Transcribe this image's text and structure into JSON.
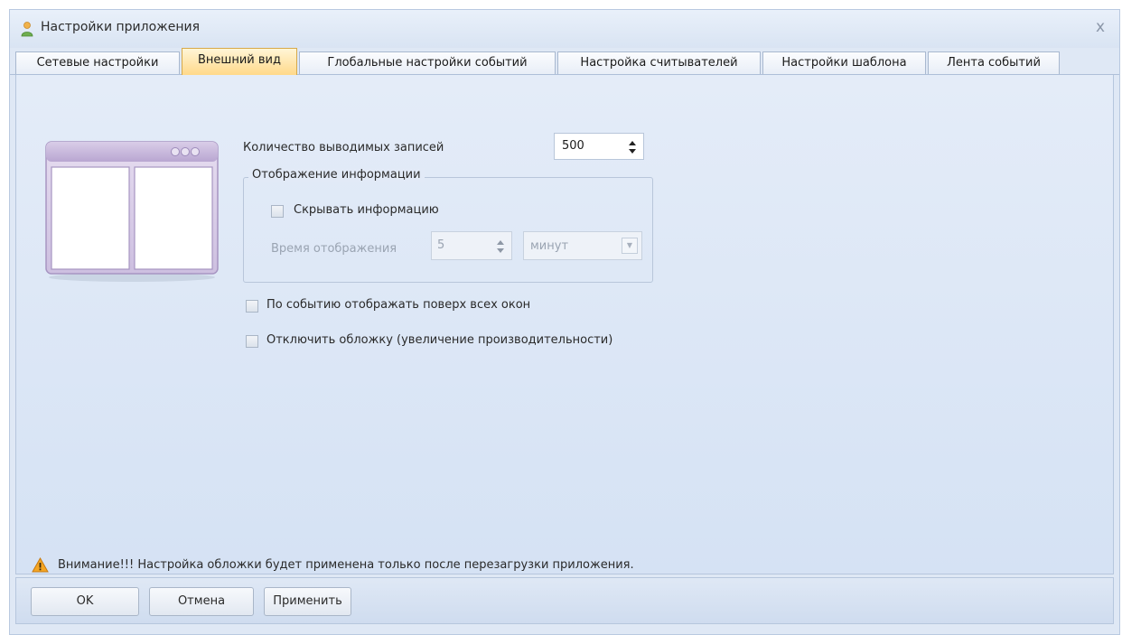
{
  "window": {
    "title": "Настройки приложения",
    "close_glyph": "x"
  },
  "tabs": [
    {
      "label": "Сетевые настройки",
      "active": false
    },
    {
      "label": "Внешний вид",
      "active": true
    },
    {
      "label": "Глобальные настройки событий",
      "active": false
    },
    {
      "label": "Настройка считывателей",
      "active": false
    },
    {
      "label": "Настройки шаблона",
      "active": false
    },
    {
      "label": "Лента событий",
      "active": false
    }
  ],
  "appearance": {
    "records_label": "Количество выводимых записей",
    "records_value": "500",
    "info_group": {
      "title": "Отображение информации",
      "hide_info_label": "Скрывать информацию",
      "hide_info_checked": false,
      "display_time_label": "Время отображения",
      "display_time_value": "5",
      "display_time_unit": "минут"
    },
    "on_top_label": "По событию отображать поверх  всех окон",
    "on_top_checked": false,
    "disable_skin_label": "Отключить обложку (увеличение производительности)",
    "disable_skin_checked": false
  },
  "warning": {
    "text": "Внимание!!!  Настройка обложки будет применена только после перезагрузки приложения.",
    "icon": "warning-icon"
  },
  "footer": {
    "ok_label": "OK",
    "cancel_label": "Отмена",
    "apply_label": "Применить"
  }
}
